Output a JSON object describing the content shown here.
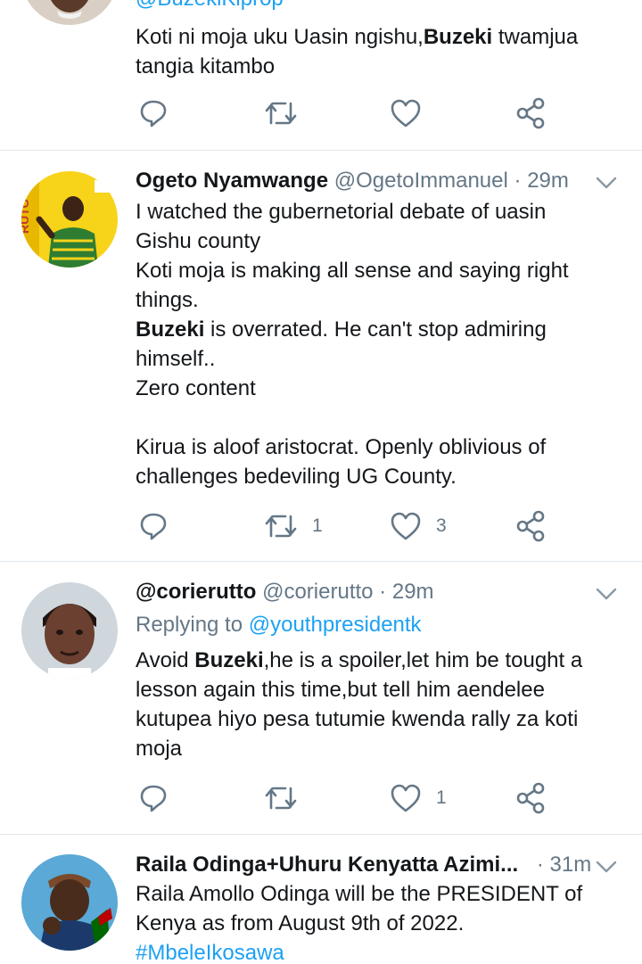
{
  "tweets": [
    {
      "handle_top": "@BuzekiKiprop",
      "body": [
        {
          "pre": "Koti ni moja uku Uasin ngishu,",
          "bold": "Buzeki",
          "post": " twamjua"
        },
        {
          "pre": "tangia kitambo",
          "bold": "",
          "post": ""
        }
      ],
      "replies": "",
      "retweets": "",
      "likes": ""
    },
    {
      "name": "Ogeto Nyamwange",
      "handle": "@OgetoImmanuel",
      "separator": "·",
      "time": "29m",
      "body": [
        {
          "pre": "I watched the gubernetorial debate of uasin",
          "bold": "",
          "post": ""
        },
        {
          "pre": "Gishu county",
          "bold": "",
          "post": ""
        },
        {
          "pre": "Koti moja is making all sense and saying right",
          "bold": "",
          "post": ""
        },
        {
          "pre": "things.",
          "bold": "",
          "post": ""
        },
        {
          "pre": "",
          "bold": "Buzeki",
          "post": " is overrated. He can't stop admiring"
        },
        {
          "pre": "himself..",
          "bold": "",
          "post": ""
        },
        {
          "pre": "Zero content",
          "bold": "",
          "post": ""
        },
        {
          "pre": " ",
          "bold": "",
          "post": ""
        },
        {
          "pre": "Kirua is aloof aristocrat. Openly oblivious of",
          "bold": "",
          "post": ""
        },
        {
          "pre": "challenges bedeviling UG County.",
          "bold": "",
          "post": ""
        }
      ],
      "retweets": "1",
      "likes": "3"
    },
    {
      "name": "@corierutto",
      "handle": "@corierutto",
      "separator": "·",
      "time": "29m",
      "replying_prefix": "Replying to",
      "replying_handle": "@youthpresidentk",
      "body": [
        {
          "pre": "Avoid ",
          "bold": "Buzeki",
          "post": ",he is a spoiler,let him be tought a"
        },
        {
          "pre": "lesson again this time,but tell him aendelee",
          "bold": "",
          "post": ""
        },
        {
          "pre": "kutupea hiyo pesa tutumie kwenda rally za koti",
          "bold": "",
          "post": ""
        },
        {
          "pre": "moja",
          "bold": "",
          "post": ""
        }
      ],
      "likes": "1"
    },
    {
      "name": "Raila Odinga+Uhuru Kenyatta Azimi...",
      "separator": "·",
      "time": "31m",
      "body": [
        {
          "pre": "Raila Amollo Odinga will be the PRESIDENT of",
          "bold": "",
          "post": ""
        },
        {
          "pre": "Kenya as from August 9th of 2022.",
          "bold": "",
          "post": ""
        }
      ],
      "hashtag": "#MbeleIkosawa"
    }
  ],
  "colors": {
    "text": "#14171a",
    "secondary": "#657786",
    "link": "#1da1f2",
    "divider": "#e1e8ed"
  },
  "icons": [
    "reply-icon",
    "retweet-icon",
    "like-icon",
    "share-icon",
    "chevron-down-icon"
  ]
}
